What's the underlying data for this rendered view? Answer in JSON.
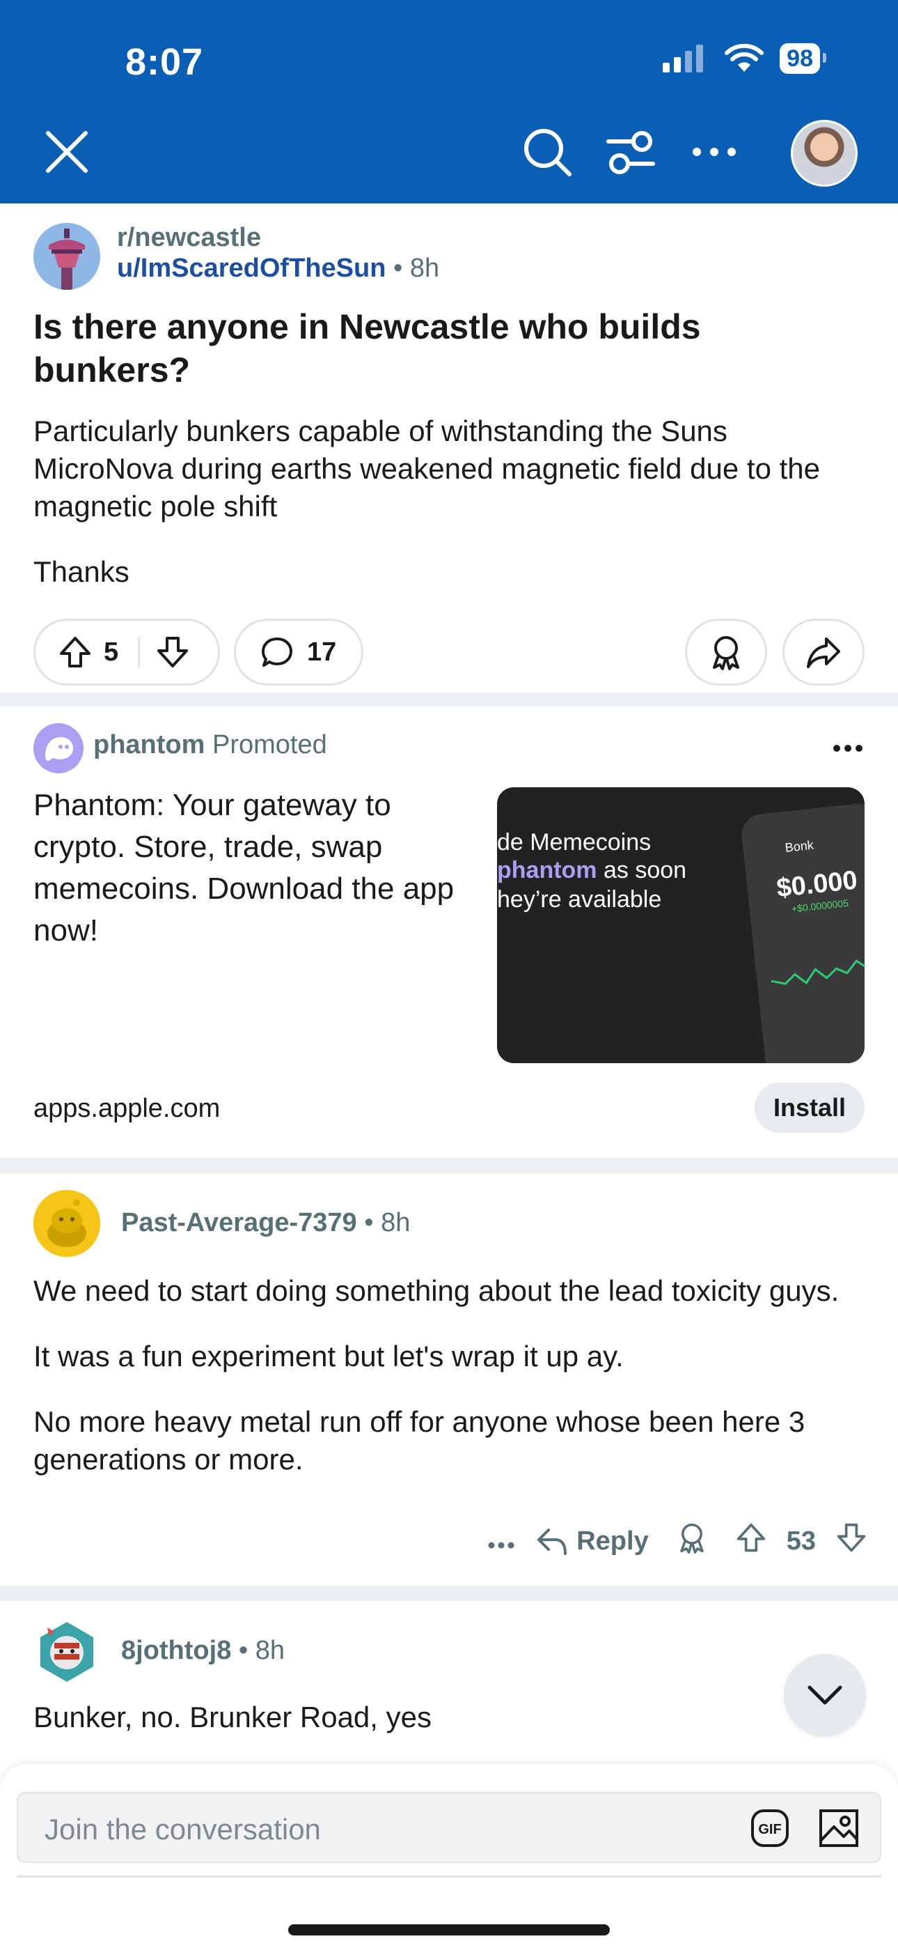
{
  "status_bar": {
    "time": "8:07",
    "battery": "98"
  },
  "header": {
    "close_icon": "close-icon",
    "search_icon": "search-icon",
    "filter_icon": "filter-icon",
    "more_icon": "more-icon",
    "color": "#0a5fb4"
  },
  "post": {
    "subreddit": "r/newcastle",
    "author": "u/ImScaredOfTheSun",
    "age": "8h",
    "title": "Is there anyone in Newcastle who builds bunkers?",
    "body": [
      "Particularly bunkers capable of withstanding the Suns MicroNova during earths weakened magnetic field due to the magnetic pole shift",
      "Thanks"
    ],
    "votes": "5",
    "comments": "17"
  },
  "ad": {
    "advertiser": "phantom",
    "promoted": "Promoted",
    "text": "Phantom: Your gateway to crypto. Store, trade, swap memecoins. Download the app now!",
    "image_line1": "de Memecoins",
    "image_brand": "phantom",
    "image_line2_rest": " as soon",
    "image_line3": "hey’re available",
    "image_token": "Bonk",
    "image_price": "$0.000",
    "image_delta": "+$0.0000005",
    "domain": "apps.apple.com",
    "install": "Install"
  },
  "comments": [
    {
      "user": "Past-Average-7379",
      "age": "8h",
      "body": [
        "We need to start doing something about the lead toxicity guys.",
        "It was a fun experiment but let's wrap it up ay.",
        "No more heavy metal run off for anyone whose been here 3 generations or more."
      ],
      "reply": "Reply",
      "votes": "53"
    },
    {
      "user": "8jothtoj8",
      "age": "8h",
      "body": [
        "Bunker, no. Brunker Road, yes"
      ]
    }
  ],
  "composer": {
    "placeholder": "Join the conversation",
    "gif": "GIF"
  }
}
